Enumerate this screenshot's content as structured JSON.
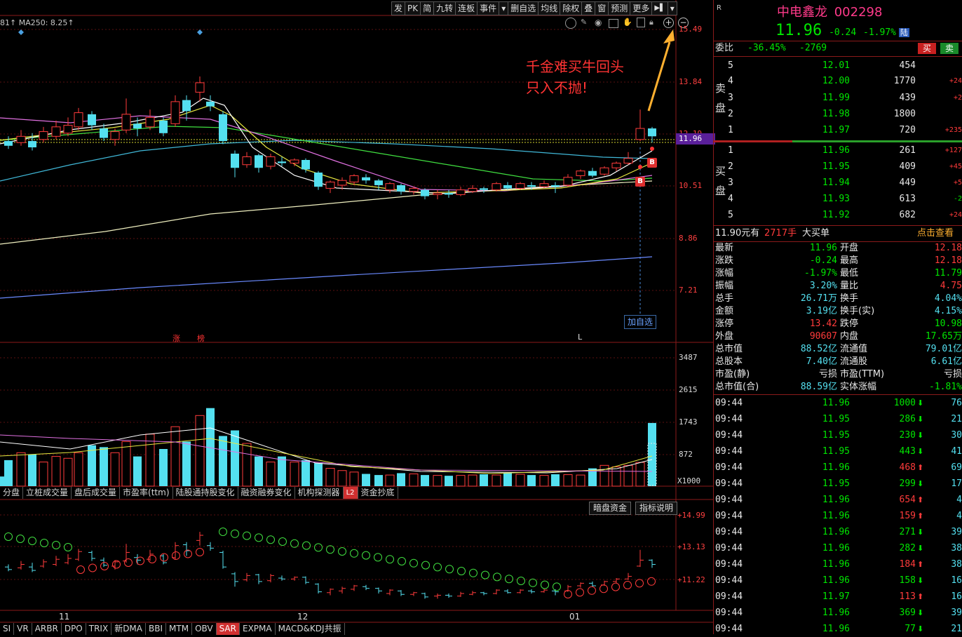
{
  "colors": {
    "up": "#ff3b3b",
    "down": "#54e0f0",
    "neutral": "#e8e8e8",
    "grid": "#8b1a1a",
    "accent": "#ffb030"
  },
  "toolbar": [
    "发",
    "PK",
    "简",
    "九转",
    "连板",
    "事件",
    "删自选",
    "均线",
    "除权",
    "叠",
    "窗",
    "预测",
    "更多"
  ],
  "toolbar_icons": [
    "dropdown-icon",
    "next-icon",
    "menu-arrow-icon"
  ],
  "ma_label": "81↑  MA250: 8.25↑",
  "chart_tools": [
    "gear-icon",
    "pen-icon",
    "eye-icon",
    "bag-icon",
    "hand-icon",
    "copy-icon",
    "lock-icon",
    "zoom-in-icon",
    "zoom-out-icon"
  ],
  "annotation": [
    "千金难买牛回头",
    "只入不抛!"
  ],
  "current_price_tag": "11.96",
  "price_axis": [
    "15.49",
    "13.84",
    "12.19",
    "10.51",
    "8.86",
    "7.21"
  ],
  "volume_axis": [
    "3487",
    "2615",
    "1743",
    "872",
    "X1000"
  ],
  "indicator_axis": [
    "+14.99",
    "+13.13",
    "+11.22"
  ],
  "markers": {
    "zhang": "涨",
    "bang": "榜",
    "L": "L",
    "b1": "B",
    "b2": "B"
  },
  "add_watch": "加自选",
  "tabs_mid": [
    "分盘",
    "立桩成交量",
    "盘后成交量",
    "市盈率(ttm)",
    "陆股通持股变化",
    "融资融券变化",
    "机构探测器",
    "资金抄底"
  ],
  "tabs_mid_badge": "L2",
  "indicator_buttons": [
    "暗盘资金",
    "指标说明"
  ],
  "x_labels": [
    "11",
    "12",
    "01"
  ],
  "tabs_bottom": [
    "SI",
    "VR",
    "ARBR",
    "DPO",
    "TRIX",
    "新DMA",
    "BBI",
    "MTM",
    "OBV",
    "SAR",
    "EXPMA",
    "MACD&KDJ共振"
  ],
  "active_bottom_tab": "SAR",
  "stock": {
    "corner": "R",
    "name": "中电鑫龙",
    "code": "002298",
    "price": "11.96",
    "change": "-0.24",
    "pct": "-1.97%",
    "tag": "陆"
  },
  "weibi": {
    "label": "委比",
    "ratio": "-36.45%",
    "diff": "-2769",
    "buy": "买",
    "sell": "卖"
  },
  "sell_label": [
    "卖",
    "盘"
  ],
  "buy_label": [
    "买",
    "盘"
  ],
  "asks": [
    {
      "lvl": "5",
      "price": "12.01",
      "vol": "454",
      "chg": ""
    },
    {
      "lvl": "4",
      "price": "12.00",
      "vol": "1770",
      "chg": "+24"
    },
    {
      "lvl": "3",
      "price": "11.99",
      "vol": "439",
      "chg": "+2"
    },
    {
      "lvl": "2",
      "price": "11.98",
      "vol": "1800",
      "chg": ""
    },
    {
      "lvl": "1",
      "price": "11.97",
      "vol": "720",
      "chg": "+235"
    }
  ],
  "bids": [
    {
      "lvl": "1",
      "price": "11.96",
      "vol": "261",
      "chg": "+127"
    },
    {
      "lvl": "2",
      "price": "11.95",
      "vol": "409",
      "chg": "+45"
    },
    {
      "lvl": "3",
      "price": "11.94",
      "vol": "449",
      "chg": "+5"
    },
    {
      "lvl": "4",
      "price": "11.93",
      "vol": "613",
      "chg": "-2"
    },
    {
      "lvl": "5",
      "price": "11.92",
      "vol": "682",
      "chg": "+24"
    }
  ],
  "bigorder": {
    "price": "11.90元有",
    "qty": "2717手",
    "label": "大买单",
    "link": "点击查看"
  },
  "stats": [
    [
      "最新",
      "11.96",
      "开盘",
      "12.18"
    ],
    [
      "涨跌",
      "-0.24",
      "最高",
      "12.18"
    ],
    [
      "涨幅",
      "-1.97%",
      "最低",
      "11.79"
    ],
    [
      "振幅",
      "3.20%",
      "量比",
      "4.75"
    ],
    [
      "总手",
      "26.71万",
      "换手",
      "4.04%"
    ],
    [
      "金额",
      "3.19亿",
      "换手(实)",
      "4.15%"
    ],
    [
      "涨停",
      "13.42",
      "跌停",
      "10.98"
    ],
    [
      "外盘",
      "90607",
      "内盘",
      "17.65万"
    ],
    [
      "总市值",
      "88.52亿",
      "流通值",
      "79.01亿"
    ],
    [
      "总股本",
      "7.40亿",
      "流通股",
      "6.61亿"
    ],
    [
      "市盈(静)",
      "亏损",
      "市盈(TTM)",
      "亏损"
    ],
    [
      "总市值(合)",
      "88.59亿",
      "实体涨幅",
      "-1.81%"
    ]
  ],
  "trades": [
    {
      "t": "09:44",
      "p": "11.96",
      "v": "1000",
      "d": "down",
      "n": "76"
    },
    {
      "t": "09:44",
      "p": "11.95",
      "v": "286",
      "d": "down",
      "n": "21"
    },
    {
      "t": "09:44",
      "p": "11.95",
      "v": "230",
      "d": "down",
      "n": "30"
    },
    {
      "t": "09:44",
      "p": "11.95",
      "v": "443",
      "d": "down",
      "n": "41"
    },
    {
      "t": "09:44",
      "p": "11.96",
      "v": "468",
      "d": "up",
      "n": "69"
    },
    {
      "t": "09:44",
      "p": "11.95",
      "v": "299",
      "d": "down",
      "n": "17"
    },
    {
      "t": "09:44",
      "p": "11.96",
      "v": "654",
      "d": "up",
      "n": "4"
    },
    {
      "t": "09:44",
      "p": "11.96",
      "v": "159",
      "d": "up",
      "n": "4"
    },
    {
      "t": "09:44",
      "p": "11.96",
      "v": "271",
      "d": "down",
      "n": "39"
    },
    {
      "t": "09:44",
      "p": "11.96",
      "v": "282",
      "d": "down",
      "n": "38"
    },
    {
      "t": "09:44",
      "p": "11.96",
      "v": "184",
      "d": "up",
      "n": "38"
    },
    {
      "t": "09:44",
      "p": "11.96",
      "v": "158",
      "d": "down",
      "n": "16"
    },
    {
      "t": "09:44",
      "p": "11.97",
      "v": "113",
      "d": "up",
      "n": "16"
    },
    {
      "t": "09:44",
      "p": "11.96",
      "v": "369",
      "d": "down",
      "n": "39"
    },
    {
      "t": "09:44",
      "p": "11.96",
      "v": "77",
      "d": "down",
      "n": "21"
    }
  ]
}
